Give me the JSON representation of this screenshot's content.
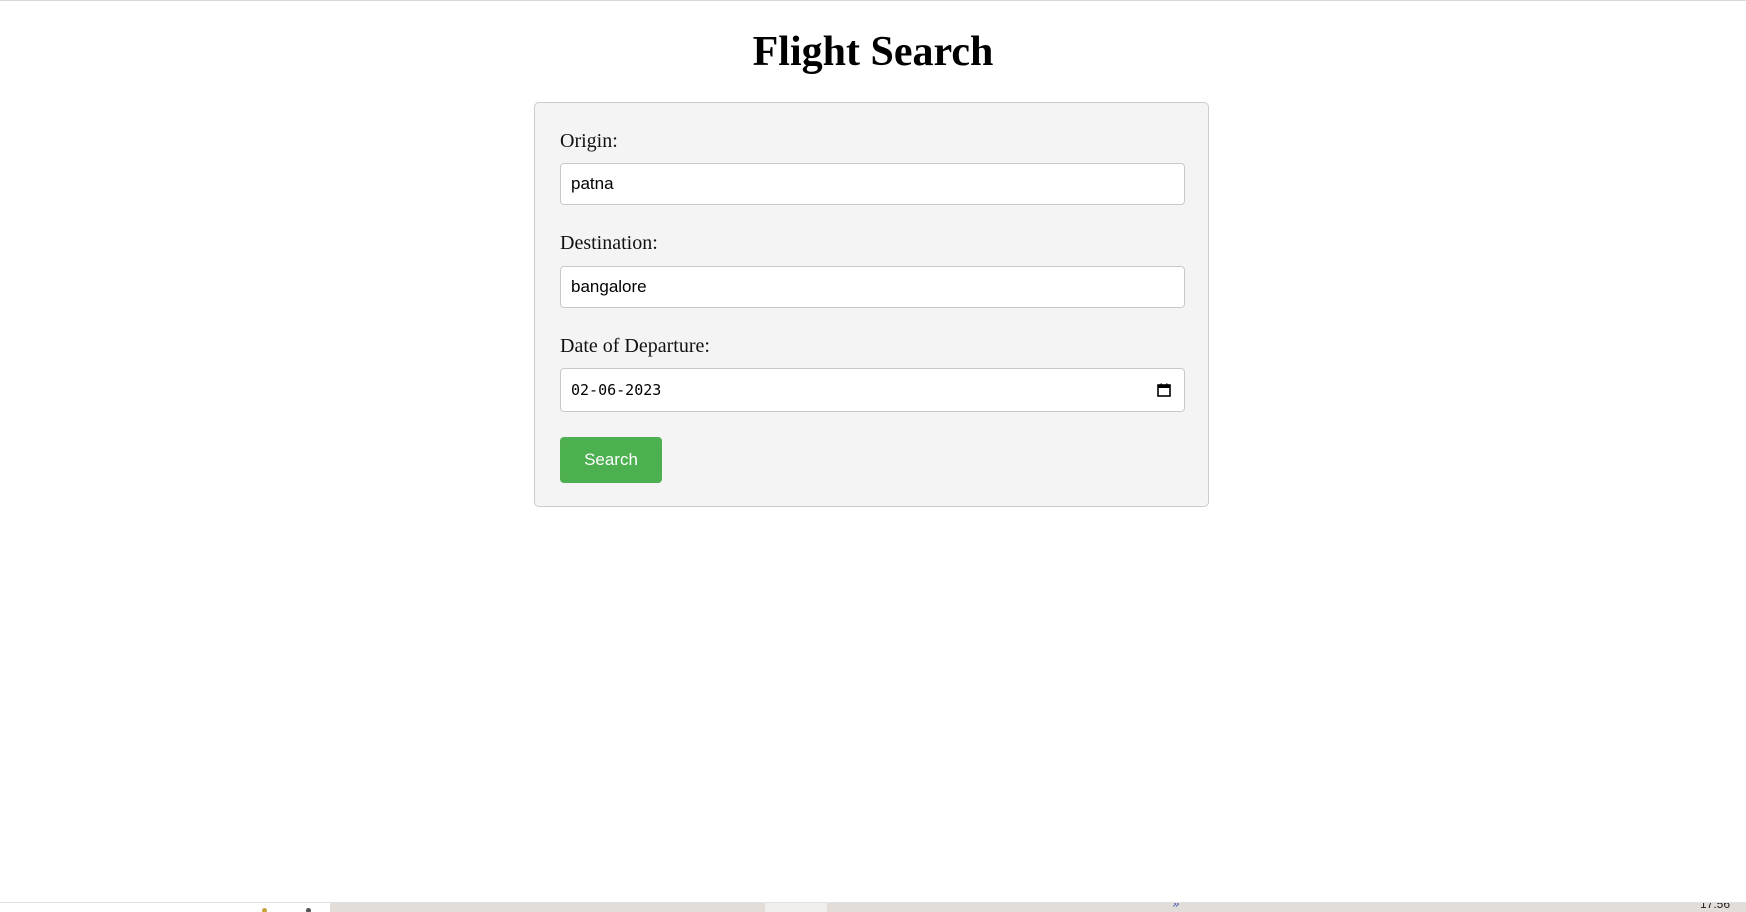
{
  "page": {
    "title": "Flight Search"
  },
  "form": {
    "origin": {
      "label": "Origin:",
      "value": "patna"
    },
    "destination": {
      "label": "Destination:",
      "value": "bangalore"
    },
    "departure_date": {
      "label": "Date of Departure:",
      "value": "02-06-2023",
      "icon": "calendar-icon"
    },
    "search_button": {
      "label": "Search",
      "color": "#4caf50"
    }
  },
  "taskbar": {
    "chevron": "»",
    "clock": "17:56"
  }
}
